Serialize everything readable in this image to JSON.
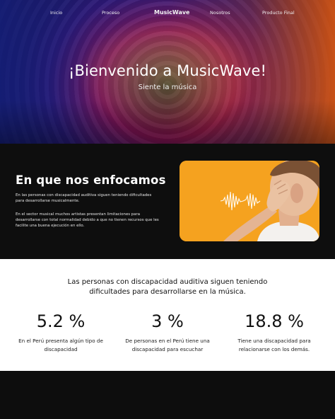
{
  "nav": {
    "items": [
      "Inicio",
      "Proceso",
      "MusicWave",
      "Nosotros",
      "Producto Final"
    ]
  },
  "hero": {
    "title": "¡Bienvenido a MusicWave!",
    "subtitle": "Siente la música"
  },
  "focus": {
    "heading": "En que nos enfocamos",
    "paragraph1": "En las personas con discapacidad auditiva siguen teniendo dificultades para desarrollarse musicalmente.",
    "paragraph2": "En el sector musical muchos artistas presentan limitaciones para desarrollarse con total normalidad debido a que no tienen recursos que les facilite una buena ejecución en ello."
  },
  "stats": {
    "heading": "Las personas con discapacidad auditiva siguen teniendo dificultades para desarrollarse en la música.",
    "items": [
      {
        "value": "5.2 %",
        "text": "En el Perú presenta algún tipo de discapacidad"
      },
      {
        "value": "3 %",
        "text": "De personas en el Perú tiene una discapacidad para escuchar"
      },
      {
        "value": "18.8 %",
        "text": "Tiene una discapacidad para relacionarse con los demás."
      }
    ]
  },
  "colors": {
    "dark_bg": "#0e0e0e",
    "photo_bg": "#f5a21f",
    "stats_bg": "#ffffff"
  }
}
